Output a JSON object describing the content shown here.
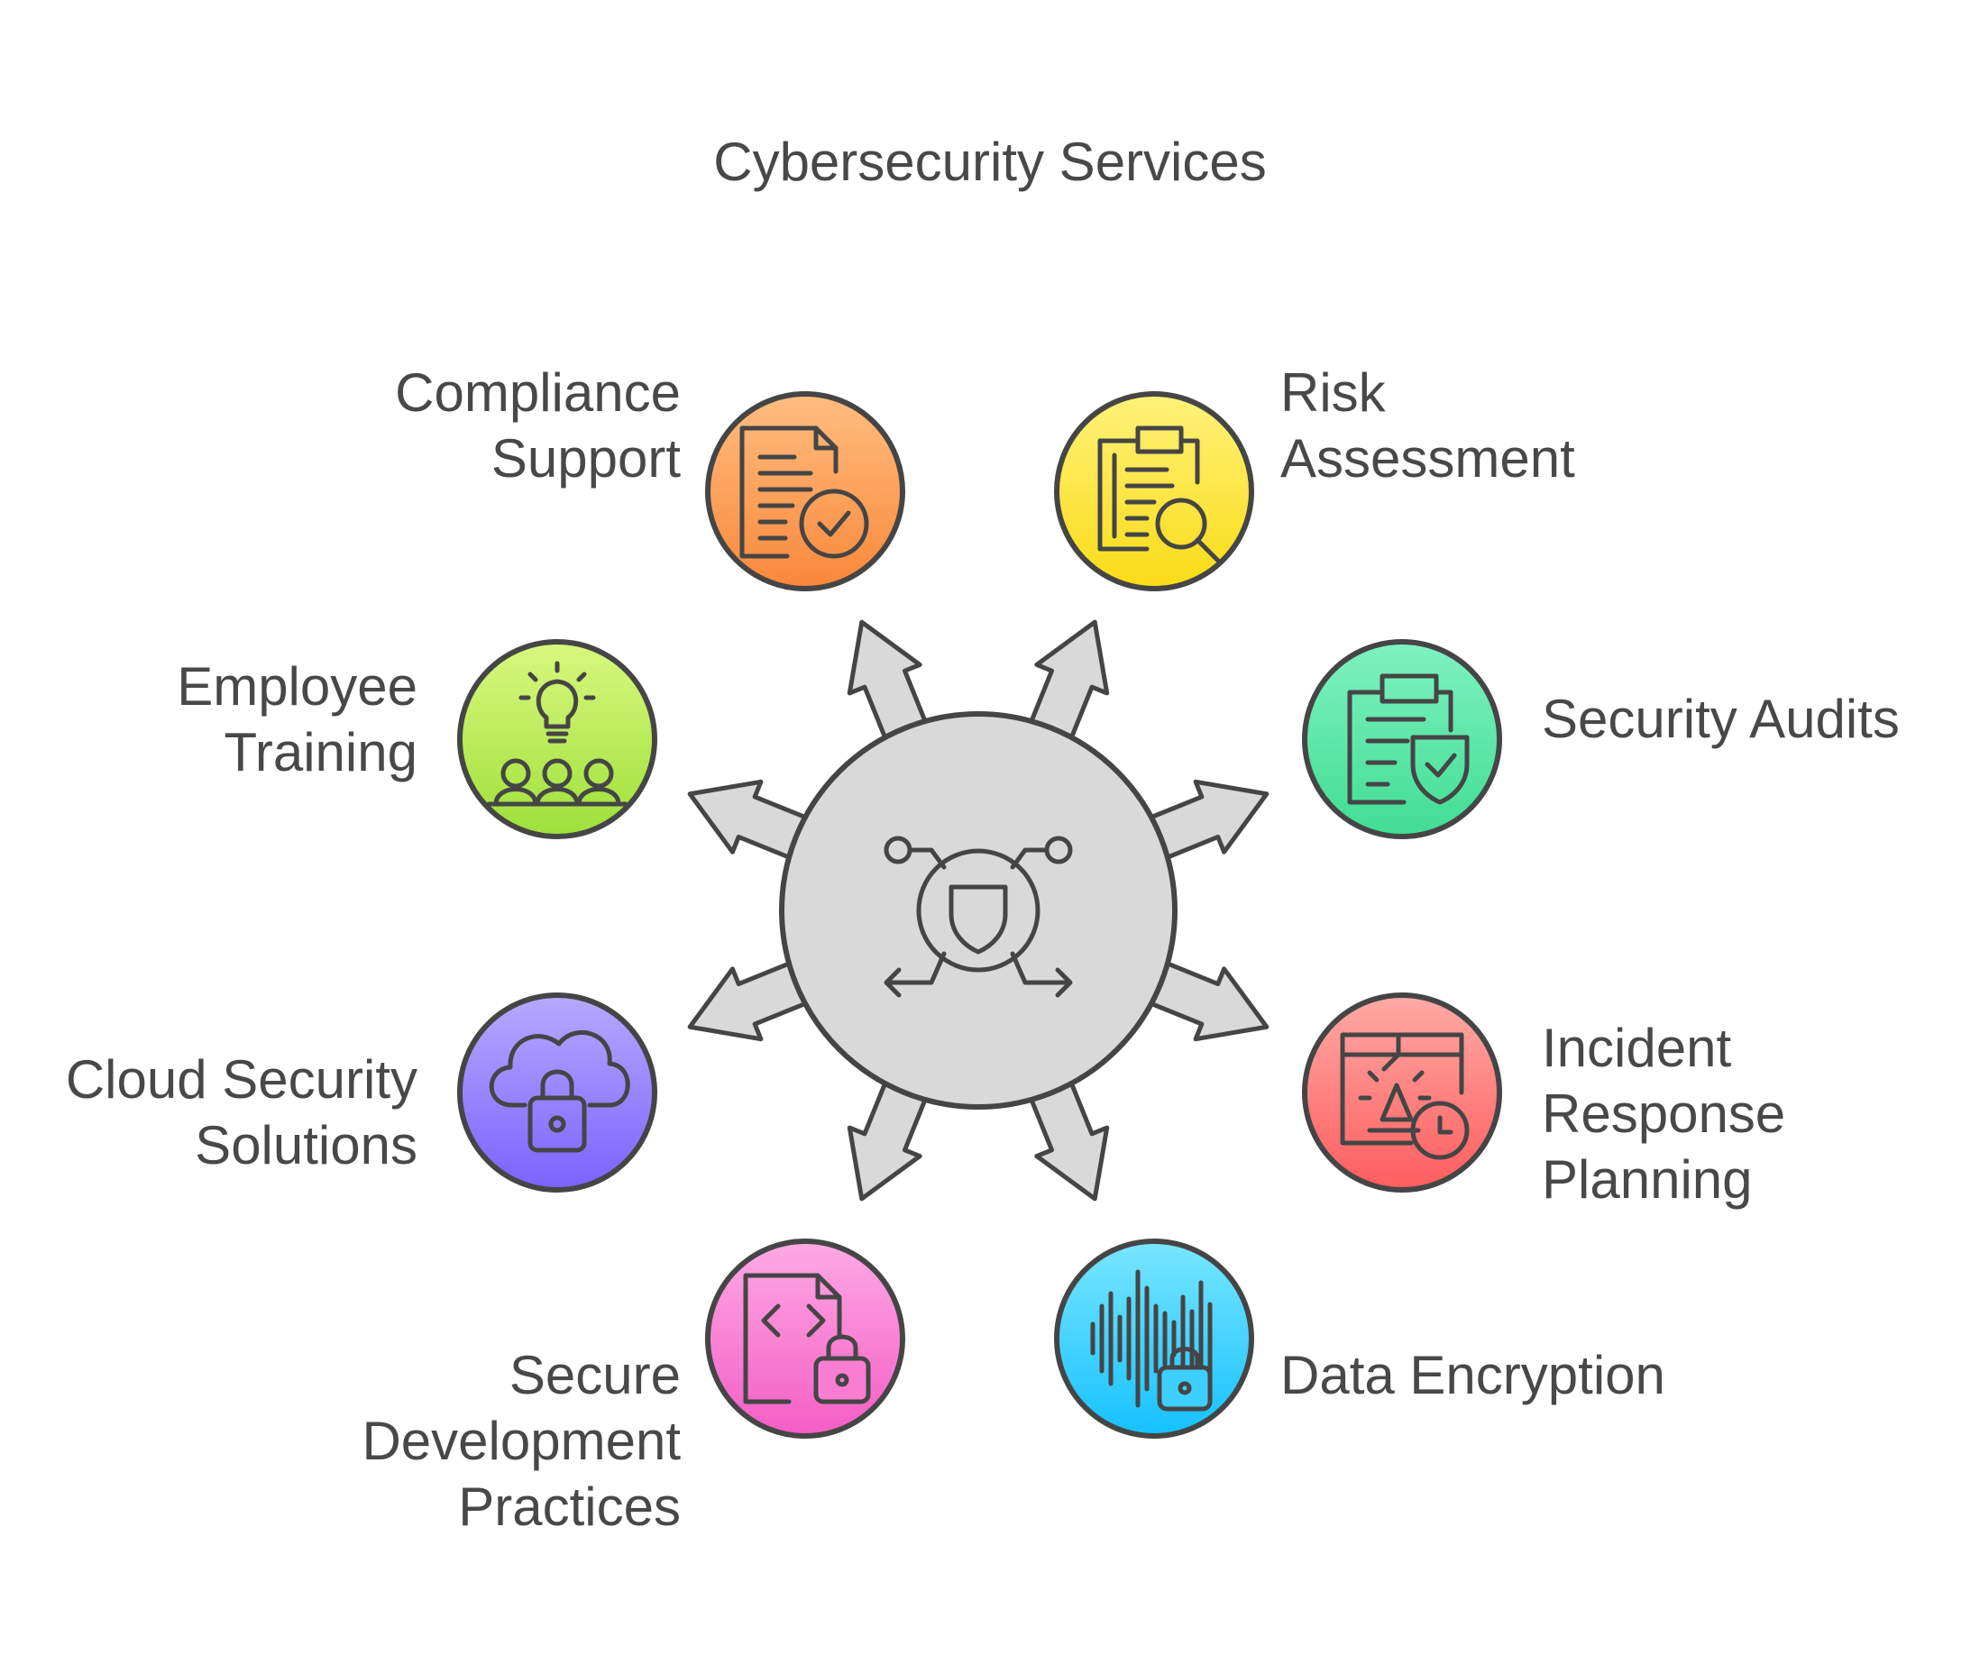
{
  "title": "Cybersecurity Services",
  "center": {
    "icon": "shield-network-icon",
    "color": "#d9d9d9"
  },
  "services": [
    {
      "lines": [
        "Compliance",
        "Support"
      ],
      "icon": "document-check-icon",
      "color_top": "#ffbd80",
      "color_bottom": "#f9883a"
    },
    {
      "lines": [
        "Risk",
        "Assessment"
      ],
      "icon": "clipboard-search-icon",
      "color_top": "#fff27a",
      "color_bottom": "#fadb16"
    },
    {
      "lines": [
        "Security Audits"
      ],
      "icon": "clipboard-shield-icon",
      "color_top": "#7ff2c1",
      "color_bottom": "#41dd92"
    },
    {
      "lines": [
        "Incident",
        "Response",
        "Planning"
      ],
      "icon": "alarm-clock-icon",
      "color_top": "#ffaaa6",
      "color_bottom": "#ff5d5d"
    },
    {
      "lines": [
        "Data Encryption"
      ],
      "icon": "audio-lock-icon",
      "color_top": "#79e6ff",
      "color_bottom": "#15c1ff"
    },
    {
      "lines": [
        "Secure",
        "Development",
        "Practices"
      ],
      "icon": "code-file-lock-icon",
      "color_top": "#ffa9e5",
      "color_bottom": "#f35ec4"
    },
    {
      "lines": [
        "Cloud Security",
        "Solutions"
      ],
      "icon": "cloud-lock-icon",
      "color_top": "#b6a9ff",
      "color_bottom": "#7c62ff"
    },
    {
      "lines": [
        "Employee",
        "Training"
      ],
      "icon": "idea-team-icon",
      "color_top": "#d8f87e",
      "color_bottom": "#9fe03a"
    }
  ]
}
